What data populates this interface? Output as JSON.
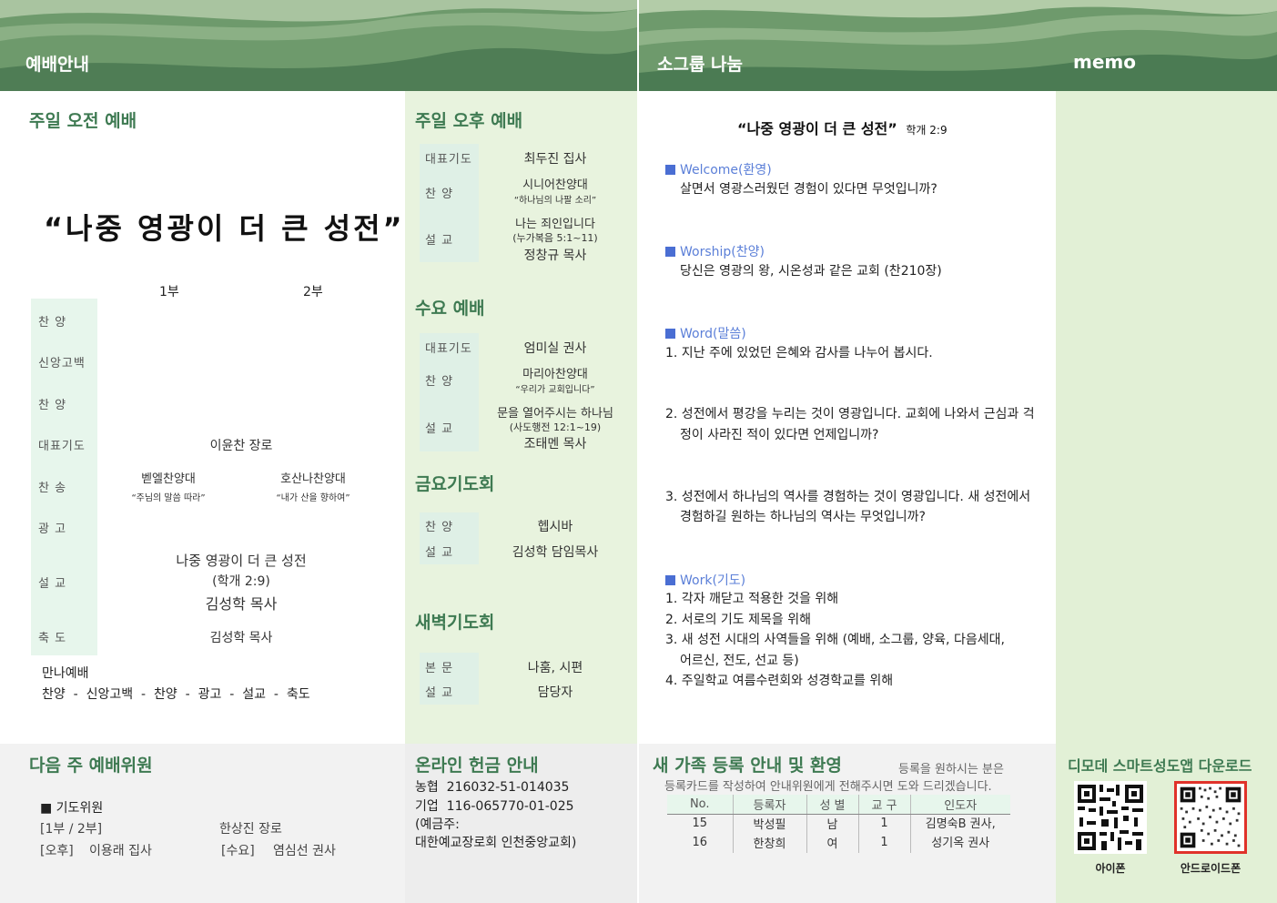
{
  "headers": {
    "left": "예배안내",
    "middle": "소그룹 나눔",
    "right": "memo"
  },
  "sunday_morning": {
    "title": "주일 오전 예배",
    "big_title": "“나중 영광이 더 큰 성전”",
    "col1": "1부",
    "col2": "2부",
    "rows": [
      {
        "label": "찬    양"
      },
      {
        "label": "신앙고백"
      },
      {
        "label": "찬    양"
      },
      {
        "label": "대표기도",
        "value": "이윤찬 장로"
      },
      {
        "label": "찬    송",
        "v1": "벧엘찬양대",
        "v1_sub": "“주님의 말씀 따라”",
        "v2": "호산나찬양대",
        "v2_sub": "“내가 산을 향하여”"
      },
      {
        "label": "광    고"
      },
      {
        "label": "설    교",
        "line1": "나중 영광이 더 큰 성전",
        "line2": "(학개 2:9)",
        "line3": "김성학 목사"
      },
      {
        "label": "축    도",
        "value": "김성학 목사"
      }
    ],
    "manna_title": "만나예배",
    "manna_order": "찬양  -  신앙고백  -  찬양  -  광고  -  설교  -  축도"
  },
  "sunday_afternoon": {
    "title": "주일 오후 예배",
    "rows": [
      {
        "label": "대표기도",
        "value": "최두진 집사"
      },
      {
        "label": "찬    양",
        "value": "시니어찬양대",
        "sub": "“하나님의 나팔 소리”"
      },
      {
        "label": "설    교",
        "value": "나는 죄인입니다",
        "sub": "(누가복음 5:1~11)",
        "value2": "정창규 목사"
      }
    ]
  },
  "wednesday": {
    "title": "수요 예배",
    "rows": [
      {
        "label": "대표기도",
        "value": "엄미실 권사"
      },
      {
        "label": "찬    양",
        "value": "마리아찬양대",
        "sub": "“우리가 교회입니다”"
      },
      {
        "label": "설    교",
        "value": "문을 열어주시는 하나님",
        "sub": "(사도행전 12:1~19)",
        "value2": "조태멘 목사"
      }
    ]
  },
  "friday": {
    "title": "금요기도회",
    "rows": [
      {
        "label": "찬    양",
        "value": "헵시바"
      },
      {
        "label": "설    교",
        "value": "김성학 담임목사"
      }
    ]
  },
  "dawn": {
    "title": "새벽기도회",
    "rows": [
      {
        "label": "본    문",
        "value": "나훔, 시편"
      },
      {
        "label": "설    교",
        "value": "담당자"
      }
    ]
  },
  "next_week": {
    "title": "다음 주 예배위원",
    "sub_title": "■ 기도위원",
    "r1_label": "[1부 / 2부]",
    "r1_value": "한상진 장로",
    "r2_label": "[오후]",
    "r2_value": "이용래 집사",
    "r3_label": "[수요]",
    "r3_value": "염심선 권사"
  },
  "offering": {
    "title": "온라인 헌금 안내",
    "line1": "농협  216032-51-014035",
    "line2": "기업  116-065770-01-025",
    "line3": "(예금주:",
    "line4": "대한예교장로회 인천중앙교회)"
  },
  "small_group": {
    "title": "“나중 영광이 더 큰 성전”",
    "ref": "학개 2:9",
    "welcome_head": "Welcome(환영)",
    "welcome_q": "살면서 영광스러웠던 경험이 있다면 무엇입니까?",
    "worship_head": "Worship(찬양)",
    "worship_q": "당신은 영광의 왕, 시온성과 같은 교회 (찬210장)",
    "word_head": "Word(말씀)",
    "word_q1": "1. 지난 주에 있었던 은혜와 감사를 나누어 봅시다.",
    "word_q2a": "2. 성전에서 평강을 누리는 것이 영광입니다. 교회에 나와서 근심과 걱",
    "word_q2b": "정이 사라진 적이 있다면 언제입니까?",
    "word_q3a": "3. 성전에서 하나님의 역사를 경험하는 것이 영광입니다. 새 성전에서",
    "word_q3b": "경험하길 원하는 하나님의 역사는 무엇입니까?",
    "work_head": "Work(기도)",
    "work_1": "1. 각자 깨닫고 적용한 것을 위해",
    "work_2": "2. 서로의 기도 제목을 위해",
    "work_3a": "3. 새 성전 시대의 사역들을 위해 (예배, 소그룹, 양육, 다음세대,",
    "work_3b": "어르신, 전도, 선교 등)",
    "work_4": "4. 주일학교 여름수련회와 성경학교를 위해"
  },
  "registration": {
    "title": "새 가족 등록 안내 및 환영",
    "note1": "등록을 원하시는 분은",
    "note2": "등록카드를 작성하여 안내위원에게 전해주시면 도와 드리겠습니다.",
    "headers": [
      "No.",
      "등록자",
      "성 별",
      "교 구",
      "인도자"
    ],
    "rows": [
      [
        "15",
        "박성필",
        "남",
        "1"
      ],
      [
        "16",
        "한창희",
        "여",
        "1"
      ]
    ],
    "guide1": "김명숙B 권사,",
    "guide2": "성기옥 권사"
  },
  "app": {
    "title": "디모데 스마트성도앱 다운로드",
    "iphone": "아이폰",
    "android": "안드로이드폰"
  },
  "colors": {
    "header_green": "#5e8a5f",
    "accent_green": "#3e7a52",
    "light_green_panel": "#e8f3de",
    "label_bg": "#e7f6ec",
    "gray_bottom": "#f2f2f2",
    "blue": "#4a6ed3"
  }
}
